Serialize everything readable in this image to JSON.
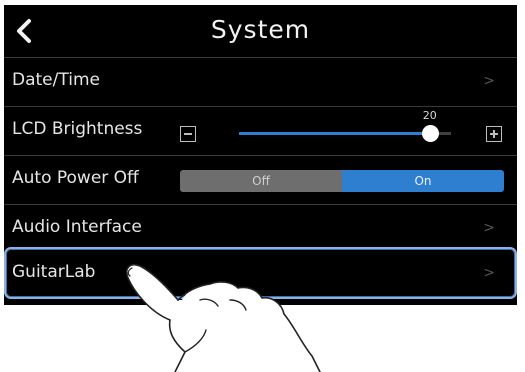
{
  "header": {
    "title": "System",
    "back_icon": "chevron-left-icon"
  },
  "rows": {
    "date_time": {
      "label": "Date/Time",
      "chevron": ">"
    },
    "lcd_brightness": {
      "label": "LCD Brightness",
      "value": "20",
      "level_fraction": 0.9,
      "decrease_icon": "minus-square-icon",
      "increase_icon": "plus-square-icon"
    },
    "auto_power_off": {
      "label": "Auto Power Off",
      "options": [
        "Off",
        "On"
      ],
      "selected": "On"
    },
    "audio_interface": {
      "label": "Audio Interface",
      "chevron": ">"
    },
    "guitarlab": {
      "label": "GuitarLab",
      "chevron": ">",
      "highlighted": true
    }
  },
  "colors": {
    "background": "#000000",
    "accent": "#2f7fd0",
    "toggle_off": "#6e6e6e",
    "highlight": "#8fb1dc"
  }
}
